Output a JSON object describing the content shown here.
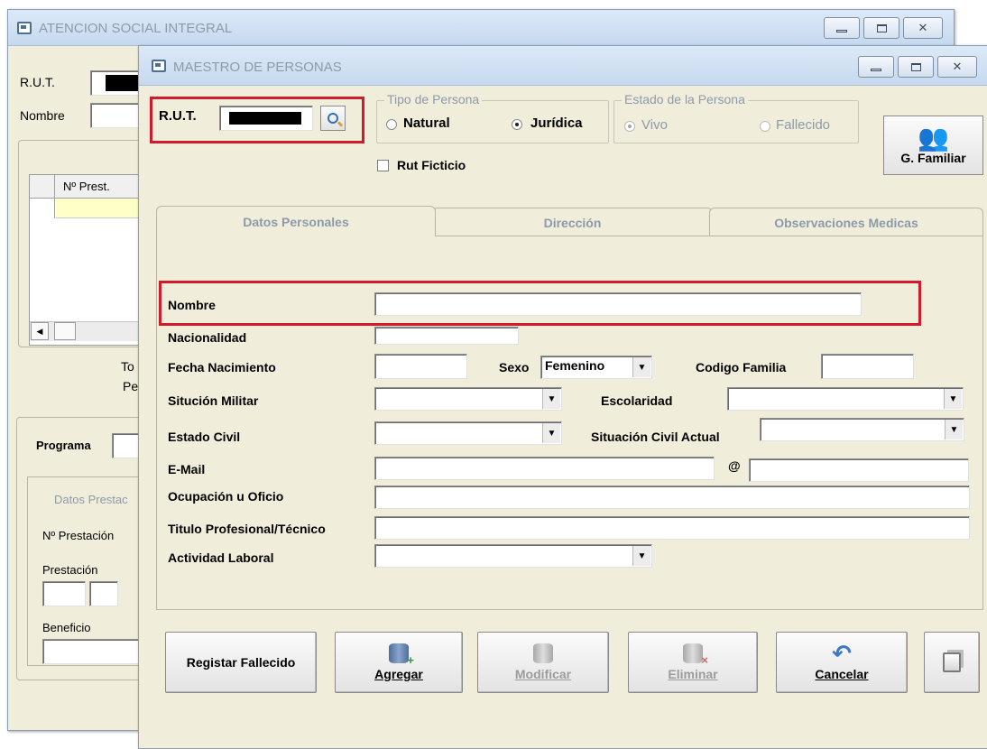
{
  "back_window": {
    "title": "ATENCION SOCIAL INTEGRAL",
    "rut_label": "R.U.T.",
    "nombre_label": "Nombre",
    "grid_header": "Nº Prest.",
    "summary_label_1": "To",
    "summary_label_2": "Pe",
    "programa_label": "Programa",
    "datos_prestacion_tab": "Datos Prestac",
    "nro_prestacion_label": "Nº Prestación",
    "prestacion_label": "Prestación",
    "beneficio_label": "Beneficio",
    "scroll_left_arrow": "◀"
  },
  "front_window": {
    "title": "MAESTRO DE PERSONAS",
    "rut_label": "R.U.T.",
    "rut_value_redacted": true,
    "tipo_persona": {
      "group_label": "Tipo de Persona",
      "options": [
        "Natural",
        "Jurídica"
      ],
      "selected": "Jurídica"
    },
    "estado_persona": {
      "group_label": "Estado de la Persona",
      "options": [
        "Vivo",
        "Fallecido"
      ],
      "selected": "Vivo",
      "disabled": true
    },
    "rut_ficticio_label": "Rut Ficticio",
    "rut_ficticio_checked": false,
    "g_familiar_label": "G. Familiar",
    "tabs": [
      "Datos Personales",
      "Dirección",
      "Observaciones Medicas"
    ],
    "active_tab": "Datos Personales",
    "form": {
      "nombre_label": "Nombre",
      "nombre_value": "",
      "nacionalidad_label": "Nacionalidad",
      "nacionalidad_value": "",
      "fecha_nacimiento_label": "Fecha Nacimiento",
      "fecha_nacimiento_value": "",
      "sexo_label": "Sexo",
      "sexo_value": "Femenino",
      "codigo_familia_label": "Codigo Familia",
      "codigo_familia_value": "",
      "situacion_militar_label": "Situción Militar",
      "situacion_militar_value": "",
      "escolaridad_label": "Escolaridad",
      "escolaridad_value": "",
      "estado_civil_label": "Estado Civil",
      "estado_civil_value": "",
      "situacion_civil_actual_label": "Situación Civil Actual",
      "situacion_civil_actual_value": "",
      "email_label": "E-Mail",
      "email_user_value": "",
      "email_at": "@",
      "email_domain_value": "",
      "ocupacion_label": "Ocupación u Oficio",
      "ocupacion_value": "",
      "titulo_label": "Titulo Profesional/Técnico",
      "titulo_value": "",
      "actividad_label": "Actividad Laboral",
      "actividad_value": ""
    },
    "buttons": {
      "registrar_fallecido": "Registar Fallecido",
      "agregar": "Agregar",
      "modificar": "Modificar",
      "eliminar": "Eliminar",
      "cancelar": "Cancelar"
    }
  },
  "window_controls": {
    "minimize": "—",
    "maximize": "□",
    "close": "✕"
  },
  "dropdown_arrow": "▼",
  "colors": {
    "window_bg": "#f0eeda",
    "highlight_red": "#d11a2a",
    "title_gray": "#8d9aab"
  }
}
